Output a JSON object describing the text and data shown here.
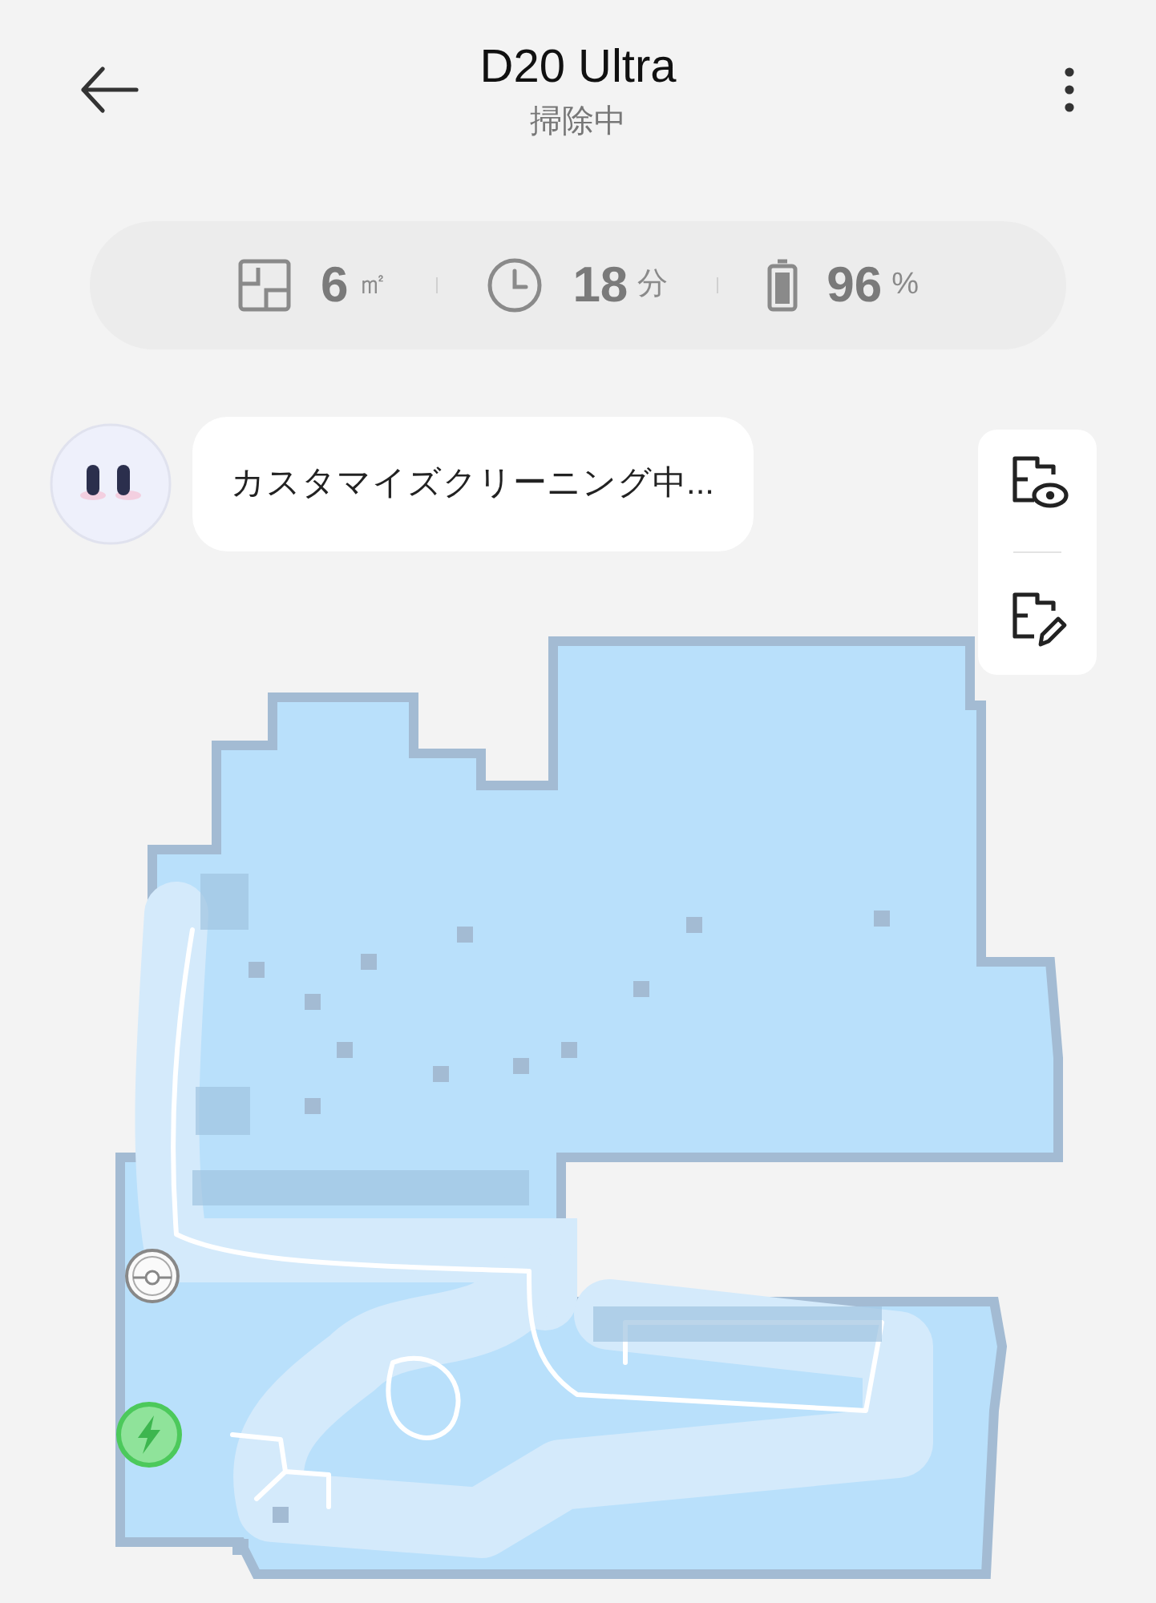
{
  "header": {
    "title": "D20 Ultra",
    "subtitle": "掃除中"
  },
  "stats": [
    {
      "kind": "area",
      "value": "6",
      "unit": "㎡"
    },
    {
      "kind": "time",
      "value": "18",
      "unit": "分"
    },
    {
      "kind": "battery",
      "value": "96",
      "unit": "%"
    }
  ],
  "status_message": "カスタマイズクリーニング中...",
  "map_tools": [
    {
      "kind": "view"
    },
    {
      "kind": "edit"
    }
  ]
}
